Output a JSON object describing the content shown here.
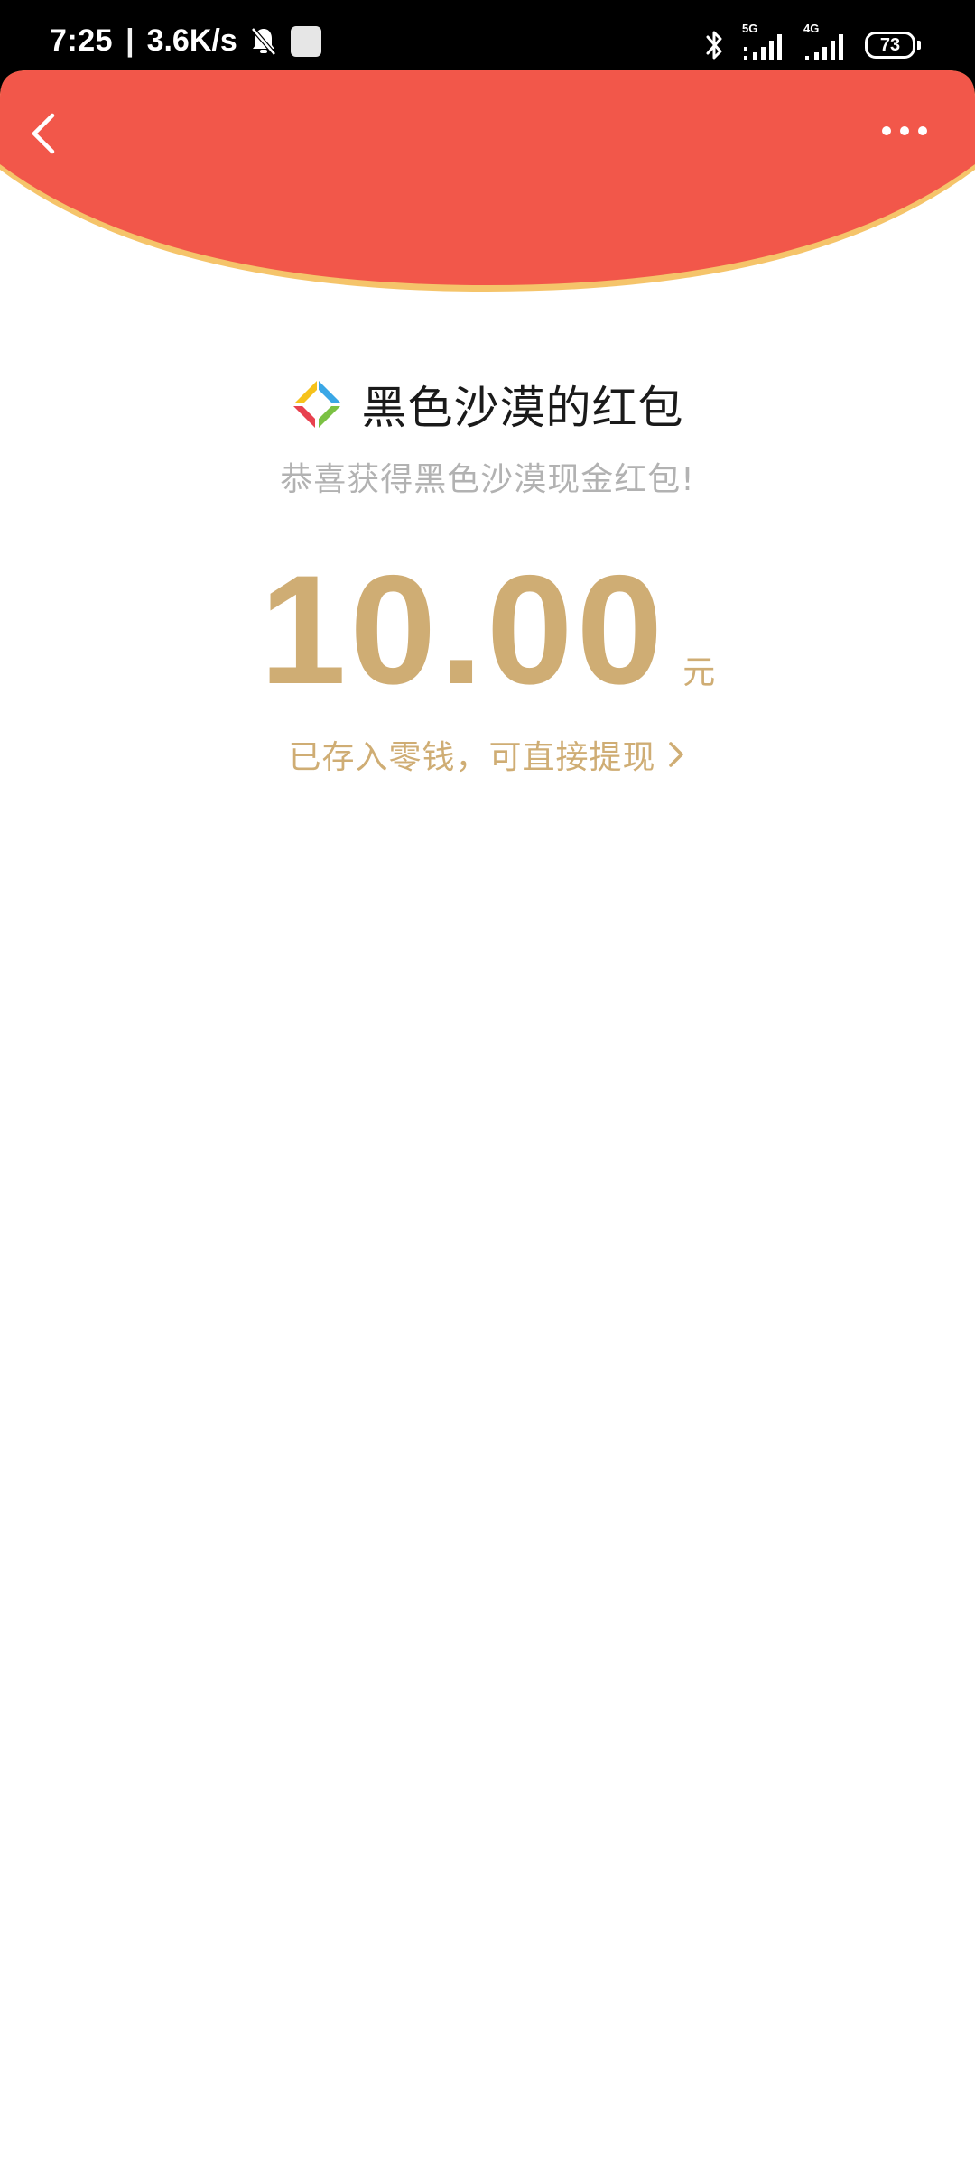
{
  "status_bar": {
    "time": "7:25",
    "separator": "|",
    "net_speed": "3.6K/s",
    "signal_1_tag": "5G",
    "signal_2_tag": "4G",
    "battery": "73",
    "icons": [
      "mute-bell-icon",
      "notification-square-icon",
      "bluetooth-icon",
      "signal-5g-icon",
      "signal-4g-icon",
      "battery-icon"
    ]
  },
  "header": {
    "color": "#f2574a",
    "rim_color": "#f5c46a",
    "back_icon": "chevron-left-icon",
    "more_icon": "more-dots-icon"
  },
  "red_packet": {
    "title": "黑色沙漠的红包",
    "subtitle": "恭喜获得黑色沙漠现金红包!",
    "amount": "10.00",
    "unit": "元",
    "wallet_note": "已存入零钱，可直接提现",
    "logo_icon": "game-logo-icon",
    "accent_color": "#cfad74"
  }
}
